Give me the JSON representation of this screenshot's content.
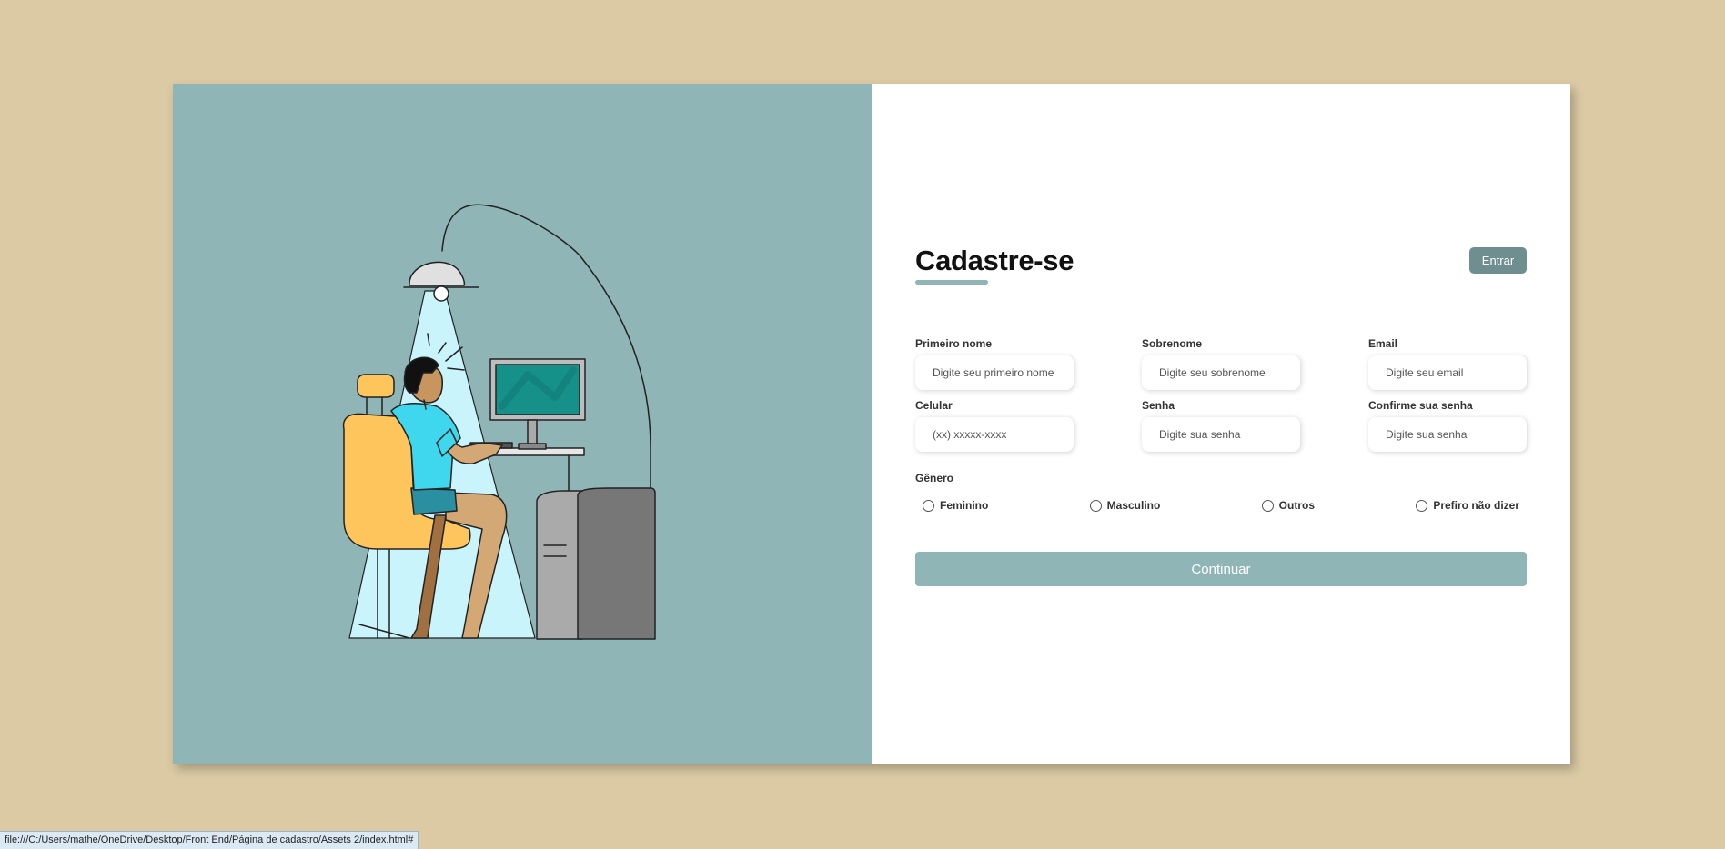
{
  "illustration": {
    "palette": {
      "panel": "#8fb5b7",
      "light_beam": "#c9f4fb",
      "chair": "#ffc55d",
      "shirt": "#3fd7ed",
      "shorts": "#2a8fa0",
      "skin": "#d4a874",
      "monitor": "#16918a",
      "tower_front": "#777777",
      "tower_side": "#aaaaaa",
      "lamp": "#e0e0e0"
    }
  },
  "form": {
    "title": "Cadastre-se",
    "login_button": "Entrar",
    "fields": [
      {
        "label": "Primeiro nome",
        "placeholder": "Digite seu primeiro nome"
      },
      {
        "label": "Sobrenome",
        "placeholder": "Digite seu sobrenome"
      },
      {
        "label": "Email",
        "placeholder": "Digite seu email"
      },
      {
        "label": "Celular",
        "placeholder": "(xx) xxxxx-xxxx"
      },
      {
        "label": "Senha",
        "placeholder": "Digite sua senha"
      },
      {
        "label": "Confirme sua senha",
        "placeholder": "Digite sua senha"
      }
    ],
    "gender": {
      "title": "Gênero",
      "options": [
        "Feminino",
        "Masculino",
        "Outros",
        "Prefiro não dizer"
      ]
    },
    "continue_button": "Continuar"
  },
  "status_bar": {
    "url": "file:///C:/Users/mathe/OneDrive/Desktop/Front End/Página de cadastro/Assets 2/index.html#"
  }
}
